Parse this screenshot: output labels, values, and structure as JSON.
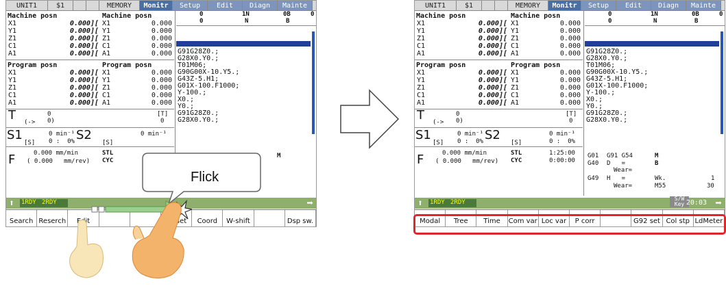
{
  "topbar": {
    "unit": "UNIT1",
    "system": "$1",
    "memory": "MEMORY",
    "monitor": "Monitr",
    "tabs": [
      "Setup",
      "Edit",
      "Diagn",
      "Mainte"
    ]
  },
  "machine_posn": {
    "title_left": "Machine posn",
    "title_right": "Machine posn",
    "axes": [
      {
        "name": "X1",
        "left": "0.000][",
        "right_name": "X1",
        "right": "0.000"
      },
      {
        "name": "Y1",
        "left": "0.000][",
        "right_name": "Y1",
        "right": "0.000"
      },
      {
        "name": "Z1",
        "left": "0.000][",
        "right_name": "Z1",
        "right": "0.000"
      },
      {
        "name": "C1",
        "left": "0.000][",
        "right_name": "C1",
        "right": "0.000"
      },
      {
        "name": "A1",
        "left": "0.000][",
        "right_name": "A1",
        "right": "0.000"
      }
    ]
  },
  "program_posn": {
    "title_left": "Program posn",
    "title_right": "Program posn",
    "axes": [
      {
        "name": "X1",
        "left": "0.000][",
        "right_name": "X1",
        "right": "0.000"
      },
      {
        "name": "Y1",
        "left": "0.000][",
        "right_name": "Y1",
        "right": "0.000"
      },
      {
        "name": "Z1",
        "left": "0.000][",
        "right_name": "Z1",
        "right": "0.000"
      },
      {
        "name": "C1",
        "left": "0.000][",
        "right_name": "C1",
        "right": "0.000"
      },
      {
        "name": "A1",
        "left": "0.000][",
        "right_name": "A1",
        "right": "0.000"
      }
    ]
  },
  "program_header": {
    "col1_top": "0",
    "col1_bottom": "0",
    "col2_top": "1N",
    "col2_bottom": "N",
    "col3_top": "0B",
    "col3_bottom": "B",
    "col4_top": "0"
  },
  "program_lines": "G91G28Z0.;\nG28X0.Y0.;\nT01M06;\nG90G00X-10.Y5.;\nG43Z-5.H1;\nG01X-100.F1000;\nY-100.;\nX0.;\nY0.;\nG91G28Z0.;\nG28X0.Y0.;",
  "tool": {
    "letter": "T",
    "arrow": "(->",
    "value": "0",
    "value2": "0)",
    "bracket": "[T]",
    "bracket_val": "0"
  },
  "spindle": {
    "s1": "S1",
    "s1_sub": "[S]",
    "s1_rpm": "0 min⁻¹",
    "s1_pct": "0 :  0%",
    "s2": "S2",
    "s2_sub": "[S]",
    "s2_rpm": "0 min⁻¹",
    "s2_pct": "0 :  0%"
  },
  "feed": {
    "letter": "F",
    "rate": "0.000 mm/min",
    "rev": "( 0.000   mm/rev)",
    "stl": "STL",
    "cyc": "CYC",
    "stl_val": "1:25:00",
    "cyc_val": "0:00:00"
  },
  "modal": {
    "g01": "G01",
    "g91": "G91 G54",
    "g40": "G40",
    "d": "D   =",
    "wear1": "Wear=",
    "g49": "G49",
    "h": "H   =",
    "wear2": "Wear=",
    "m": "M",
    "b": "B",
    "wk": "Wk.",
    "m55": "M55",
    "wk_val": "1",
    "m55_val": "30"
  },
  "status": {
    "rdy1": "1RDY",
    "rdy2": "2RDY",
    "sw_key": "S/W Key",
    "clock": "20:03"
  },
  "left_menu": [
    "Search",
    "Reserch",
    "Edit",
    "",
    "",
    "Offset",
    "Coord",
    "W-shift",
    "",
    "Dsp sw."
  ],
  "right_menu": [
    "Modal",
    "Tree",
    "Time",
    "Com var",
    "Loc var",
    "P corr",
    "",
    "G92 set",
    "Col stp",
    "LdMeter"
  ],
  "gesture": {
    "label": "Flick"
  },
  "colors": {
    "monitor_tab": "#4a6fa5",
    "other_tab": "#7d95bd",
    "highlight": "#e0262b",
    "status_green": "#8fb06d"
  }
}
